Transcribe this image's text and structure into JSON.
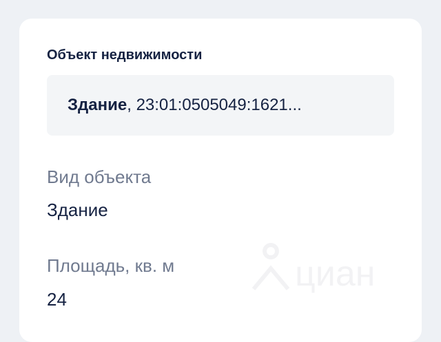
{
  "object_section": {
    "title": "Объект недвижимости",
    "object_type": "Здание",
    "object_separator": ", ",
    "cadastral_number": "23:01:0505049:1621..."
  },
  "fields": [
    {
      "label": "Вид объекта",
      "value": "Здание"
    },
    {
      "label": "Площадь, кв. м",
      "value": "24"
    }
  ],
  "watermark": {
    "brand": "циан",
    "icon": "house-pin-icon"
  },
  "colors": {
    "background": "#eef1f5",
    "card": "#ffffff",
    "box": "#f3f5f7",
    "text_primary": "#152242",
    "text_secondary": "#707a8f"
  }
}
